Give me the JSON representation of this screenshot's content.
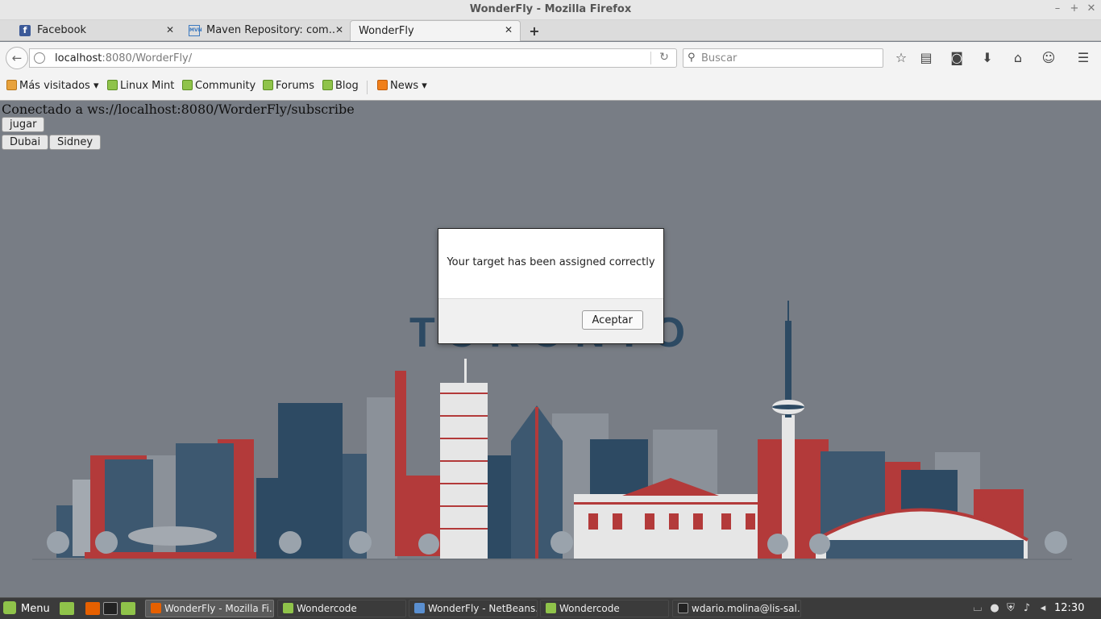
{
  "window": {
    "title": "WonderFly - Mozilla Firefox",
    "controls": [
      "–",
      "+",
      "✕"
    ]
  },
  "tabs": [
    {
      "label": "Facebook",
      "icon": "facebook-icon"
    },
    {
      "label": "Maven Repository: com...",
      "icon": "maven-icon"
    },
    {
      "label": "WonderFly",
      "icon": "none",
      "active": true
    }
  ],
  "navbar": {
    "url_host": "localhost",
    "url_rest": ":8080/WorderFly/",
    "search_placeholder": "Buscar"
  },
  "bookmarks": [
    {
      "label": "Más visitados ▾",
      "icon": "folder-icon"
    },
    {
      "label": "Linux Mint",
      "icon": "mint-icon"
    },
    {
      "label": "Community",
      "icon": "mint-icon"
    },
    {
      "label": "Forums",
      "icon": "mint-icon"
    },
    {
      "label": "Blog",
      "icon": "mint-icon"
    },
    {
      "label": "News ▾",
      "icon": "rss-icon"
    }
  ],
  "page": {
    "status": "Conectado a ws://localhost:8080/WorderFly/subscribe",
    "buttons": {
      "play": "jugar",
      "city1": "Dubai",
      "city2": "Sidney"
    },
    "city_title": "TORONTO",
    "colors": {
      "navy": "#2d4a63",
      "red": "#b33a3a",
      "grey": "#9aa0a8",
      "background": "#787d85"
    }
  },
  "dialog": {
    "message": "Your target has been assigned correctly",
    "ok_label": "Aceptar"
  },
  "taskbar": {
    "menu_label": "Menu",
    "tasks": [
      {
        "label": "WonderFly - Mozilla Fi...",
        "icon": "firefox-icon",
        "active": true
      },
      {
        "label": "Wondercode",
        "icon": "folder-icon"
      },
      {
        "label": "WonderFly - NetBeans...",
        "icon": "netbeans-icon"
      },
      {
        "label": "Wondercode",
        "icon": "folder-icon"
      },
      {
        "label": "wdario.molina@lis-sal...",
        "icon": "terminal-icon"
      }
    ],
    "clock": "12:30"
  }
}
